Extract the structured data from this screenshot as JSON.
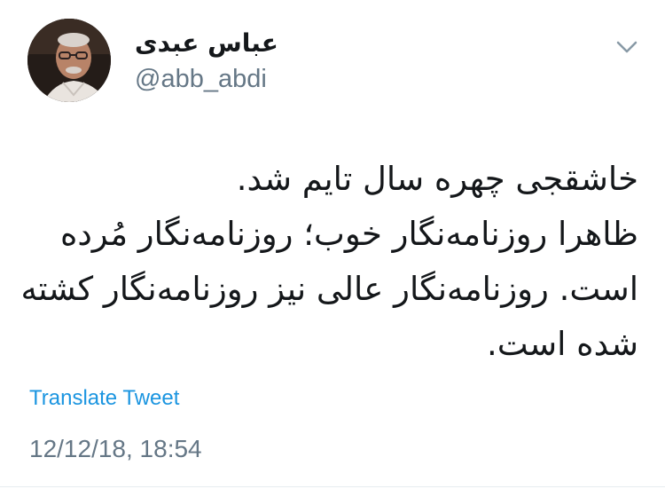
{
  "author": {
    "display_name": "عباس عبدی",
    "handle": "@abb_abdi",
    "avatar_icon": "person-portrait-icon"
  },
  "menu": {
    "icon": "chevron-down-icon"
  },
  "tweet": {
    "lines": [
      "خاشقجی چهره سال تایم شد.",
      "ظاهرا روزنامه‌نگار خوب؛ روزنامه‌نگار مُرده",
      "است. روزنامه‌نگار عالی نیز روزنامه‌نگار کشته",
      "شده است."
    ],
    "translate_label": "Translate Tweet",
    "timestamp": "12/12/18, 18:54"
  },
  "colors": {
    "text": "#14171a",
    "secondary": "#657786",
    "link": "#1b95e0",
    "divider": "#e6ecf0"
  }
}
